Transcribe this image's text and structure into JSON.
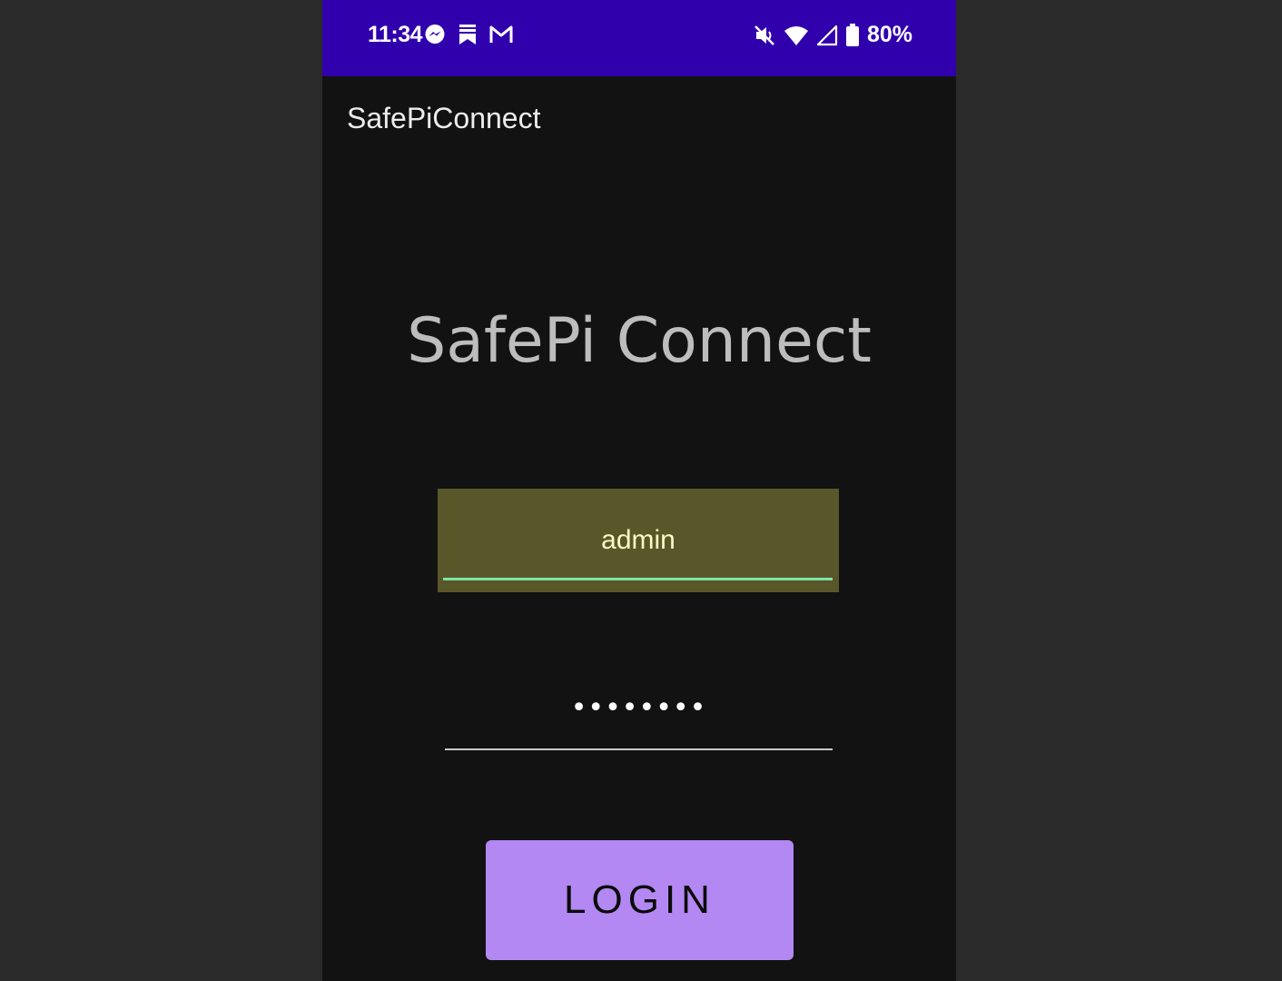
{
  "status_bar": {
    "time": "11:34",
    "battery": "80%",
    "left_icons": [
      "messenger-icon",
      "bookmark-icon",
      "gmail-icon"
    ],
    "right_icons": [
      "mute-icon",
      "wifi-icon",
      "signal-icon",
      "battery-icon"
    ],
    "background": "#3100ad"
  },
  "app_bar": {
    "title": "SafePiConnect"
  },
  "main": {
    "heading": "SafePi Connect",
    "username": {
      "value": "admin"
    },
    "password": {
      "masked_value": "••••••••"
    },
    "login_label": "LOGIN"
  },
  "colors": {
    "background": "#121212",
    "username_field_bg": "#59562a",
    "username_underline": "#7ee3a6",
    "button": "#b388f2"
  }
}
